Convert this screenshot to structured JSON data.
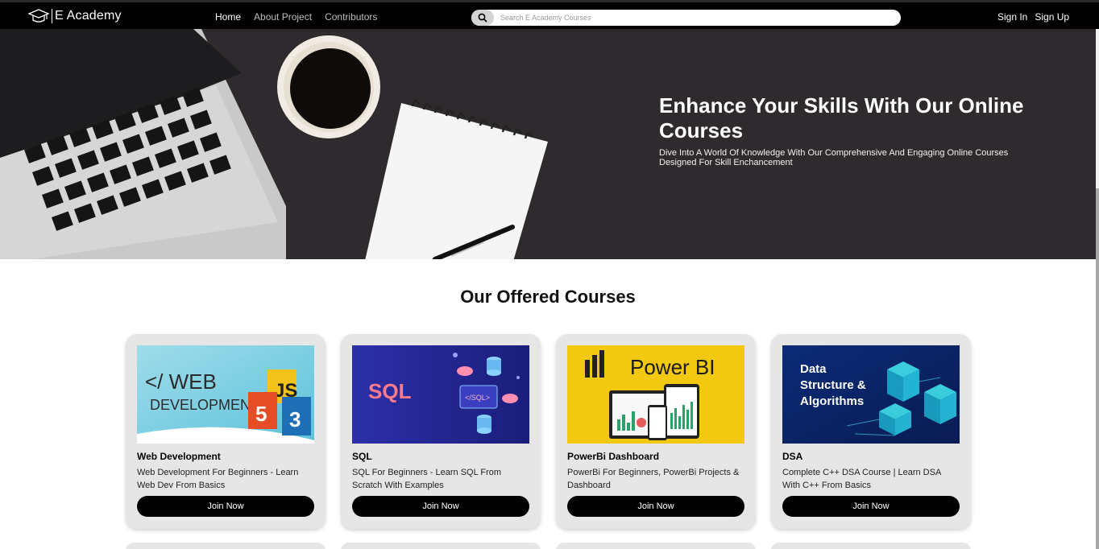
{
  "navbar": {
    "brand": "E Academy",
    "links": [
      {
        "label": "Home",
        "active": true
      },
      {
        "label": "About Project",
        "active": false
      },
      {
        "label": "Contributors",
        "active": false
      }
    ],
    "search_placeholder": "Search E Academy Courses",
    "sign_in": "Sign In",
    "sign_up": "Sign Up"
  },
  "hero": {
    "title": "Enhance Your Skills With Our Online Courses",
    "subtitle": "Dive Into A World Of Knowledge With Our Comprehensive And Engaging Online Courses Designed For Skill Enchancement"
  },
  "courses": {
    "heading": "Our Offered Courses",
    "items": [
      {
        "title": "Web Development",
        "description": "Web Development For Beginners - Learn Web Dev From Basics",
        "button": "Join Now",
        "image_text": {
          "line1": "</ WEB",
          "line2": "DEVELOPMENT>"
        }
      },
      {
        "title": "SQL",
        "description": "SQL For Beginners - Learn SQL From Scratch With Examples",
        "button": "Join Now",
        "image_text": {
          "main": "SQL",
          "tag": "</SQL>"
        }
      },
      {
        "title": "PowerBi Dashboard",
        "description": "PowerBi For Beginners, PowerBi Projects & Dashboard",
        "button": "Join Now",
        "image_text": {
          "main": "Power BI"
        }
      },
      {
        "title": "DSA",
        "description": "Complete C++ DSA Course | Learn DSA With C++ From Basics",
        "button": "Join Now",
        "image_text": {
          "line1": "Data",
          "line2": "Structure &",
          "line3": "Algorithms"
        }
      }
    ]
  },
  "colors": {
    "navbar_bg": "#000000",
    "hero_bg": "#2e2a2d",
    "card_bg": "#e6e6e6",
    "button_bg": "#000000"
  }
}
